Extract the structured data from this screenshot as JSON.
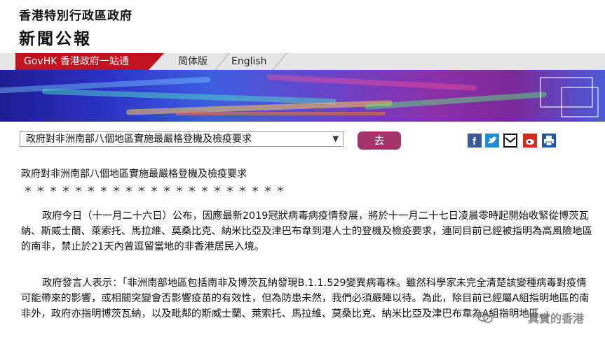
{
  "header": {
    "department": "香港特別行政區政府",
    "title": "新聞公報"
  },
  "nav": {
    "govhk": "GovHK 香港政府一站通",
    "simplified": "简体版",
    "english": "English"
  },
  "toolbar": {
    "selected_option": "政府對非洲南部八個地區實施最嚴格登機及檢疫要求",
    "go_label": "去"
  },
  "share_icons": [
    "facebook-icon",
    "twitter-icon",
    "email-icon",
    "weibo-icon",
    "print-icon"
  ],
  "article": {
    "title": "政府對非洲南部八個地區實施最嚴格登機及檢疫要求",
    "stars": "＊＊＊＊＊＊＊＊＊＊＊＊＊＊＊＊＊＊＊＊＊",
    "paragraph1": "政府今日（十一月二十六日）公布，因應最新2019冠狀病毒病疫情發展，將於十一月二十七日凌晨零時起開始收緊從博茨瓦納、斯威士蘭、萊索托、馬拉維、莫桑比克、納米比亞及津巴布韋到港人士的登機及檢疫要求，連同目前已經被指明為高風險地區的南非，禁止於21天內曾逗留當地的非香港居民入境。",
    "paragraph2": "政府發言人表示：「非洲南部地區包括南非及博茨瓦納發現B.1.1.529變異病毒株。雖然科學家未完全清楚該變種病毒對疫情可能帶來的影響，或相關突變會否影響疫苗的有效性，但為防患未然，我們必須嚴陣以待。為此，除目前已經屬A組指明地區的南非外，政府亦指明博茨瓦納，以及毗鄰的斯威士蘭、萊索托、馬拉維、莫桑比克、納米比亞及津巴布韋為A組指明地區。」"
  },
  "watermark": "真實的香港",
  "colors": {
    "govhk_red": "#c1121f",
    "go_button": "#a4326b"
  }
}
